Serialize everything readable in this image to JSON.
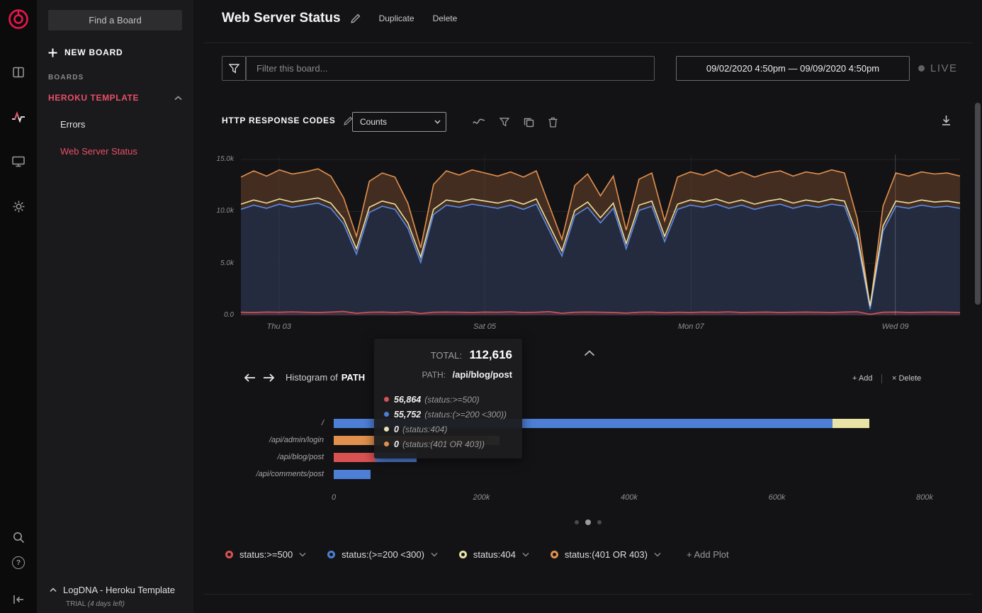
{
  "app": {
    "accent": "#e94f68",
    "logo_color": "#e8174c"
  },
  "sidebar": {
    "search_placeholder": "Find a Board",
    "new_board_label": "NEW BOARD",
    "boards_section_label": "BOARDS",
    "group_label": "HEROKU TEMPLATE",
    "boards": [
      {
        "label": "Errors",
        "active": false
      },
      {
        "label": "Web Server Status",
        "active": true
      }
    ],
    "footer_title": "LogDNA - Heroku Template",
    "footer_trial": "TRIAL",
    "footer_trial_note": "(4 days left)"
  },
  "header": {
    "title": "Web Server Status",
    "duplicate_label": "Duplicate",
    "delete_label": "Delete"
  },
  "filter_bar": {
    "filter_placeholder": "Filter this board...",
    "date_range": "09/02/2020 4:50pm — 09/09/2020 4:50pm",
    "live_label": "LIVE"
  },
  "timeseries_panel": {
    "title": "HTTP RESPONSE CODES",
    "metric_selected": "Counts"
  },
  "histogram_panel": {
    "title_prefix": "Histogram of",
    "title_field": "PATH",
    "add_label": "+ Add",
    "delete_label": "× Delete"
  },
  "tooltip": {
    "total_label": "TOTAL:",
    "total_value": "112,616",
    "path_label": "PATH:",
    "path_value": "/api/blog/post",
    "rows": [
      {
        "color": "#d95252",
        "value": "56,864",
        "query": "(status:>=500)"
      },
      {
        "color": "#4d7fd6",
        "value": "55,752",
        "query": "(status:(>=200 <300))"
      },
      {
        "color": "#e6e2b8",
        "value": "0",
        "query": "(status:404)"
      },
      {
        "color": "#e2904e",
        "value": "0",
        "query": "(status:(401 OR 403))"
      }
    ]
  },
  "legend": {
    "items": [
      {
        "label": "status:>=500",
        "color": "#d95252"
      },
      {
        "label": "status:(>=200 <300)",
        "color": "#4d7fd6"
      },
      {
        "label": "status:404",
        "color": "#e9e3a6"
      },
      {
        "label": "status:(401 OR 403)",
        "color": "#e2904e"
      }
    ],
    "add_plot_label": "+ Add Plot"
  },
  "chart_data": [
    {
      "type": "area",
      "title": "HTTP RESPONSE CODES",
      "x_range": [
        "09/02/2020 4:50pm",
        "09/09/2020 4:50pm"
      ],
      "y_unit": "thousands",
      "y_max": 15,
      "y_ticks": [
        {
          "label": "15.0k",
          "value": 15
        },
        {
          "label": "10.0k",
          "value": 10
        },
        {
          "label": "5.0k",
          "value": 5
        },
        {
          "label": "0.0",
          "value": 0
        }
      ],
      "x_ticks": [
        {
          "label": "Thu 03",
          "frac": 0.053
        },
        {
          "label": "Sat 05",
          "frac": 0.339
        },
        {
          "label": "Mon 07",
          "frac": 0.626
        },
        {
          "label": "Wed 09",
          "frac": 0.91
        }
      ],
      "series": [
        {
          "name": "status:(401 OR 403)",
          "color": "#e2904e",
          "fill": "rgba(196,118,60,0.27)",
          "values": [
            13.3,
            13.9,
            13.4,
            14.0,
            13.6,
            13.8,
            14.1,
            13.4,
            11.3,
            7.6,
            12.9,
            13.7,
            13.3,
            10.8,
            6.5,
            12.6,
            13.9,
            13.5,
            14.0,
            13.7,
            13.4,
            13.8,
            13.3,
            13.9,
            10.6,
            7.3,
            12.5,
            13.6,
            11.5,
            13.4,
            8.2,
            13.1,
            13.7,
            9.1,
            13.3,
            13.8,
            13.5,
            14.0,
            13.4,
            13.8,
            13.3,
            13.7,
            13.9,
            13.4,
            13.8,
            13.6,
            14.0,
            13.7,
            9.3,
            0.8,
            10.5,
            13.7,
            13.4,
            13.8,
            13.6,
            13.7,
            13.4
          ]
        },
        {
          "name": "status:(>=200 <300)",
          "color": "#5c8ae6",
          "fill": "rgba(34,43,66,0.93)",
          "values": [
            10.2,
            10.6,
            10.3,
            10.7,
            10.4,
            10.6,
            10.8,
            10.3,
            8.8,
            5.9,
            9.9,
            10.5,
            10.2,
            8.4,
            5.1,
            9.7,
            10.6,
            10.4,
            10.7,
            10.5,
            10.3,
            10.6,
            10.2,
            10.7,
            8.2,
            5.7,
            9.6,
            10.4,
            8.9,
            10.3,
            6.4,
            10.1,
            10.5,
            7.1,
            10.2,
            10.6,
            10.4,
            10.7,
            10.3,
            10.6,
            10.2,
            10.5,
            10.7,
            10.3,
            10.6,
            10.4,
            10.7,
            10.5,
            7.2,
            0.6,
            8.1,
            10.5,
            10.3,
            10.6,
            10.4,
            10.5,
            10.3
          ]
        },
        {
          "name": "status:404",
          "color": "#eadfa3",
          "fill": "none",
          "values": [
            10.7,
            11.1,
            10.8,
            11.2,
            10.9,
            11.1,
            11.3,
            10.8,
            9.3,
            6.4,
            10.4,
            11.0,
            10.7,
            8.9,
            5.6,
            10.2,
            11.1,
            10.9,
            11.2,
            11.0,
            10.8,
            11.1,
            10.7,
            11.2,
            8.7,
            6.2,
            10.1,
            10.9,
            9.4,
            10.8,
            6.9,
            10.6,
            11.0,
            7.6,
            10.7,
            11.1,
            10.9,
            11.2,
            10.8,
            11.1,
            10.7,
            11.0,
            11.2,
            10.8,
            11.1,
            10.9,
            11.2,
            11.0,
            7.7,
            0.9,
            8.6,
            11.0,
            10.8,
            11.1,
            10.9,
            11.0,
            10.8
          ]
        },
        {
          "name": "status:>=500",
          "color": "#d95252",
          "fill": "rgba(217,82,82,0.18)",
          "values": [
            0.3,
            0.28,
            0.32,
            0.3,
            0.34,
            0.3,
            0.28,
            0.32,
            0.38,
            0.2,
            0.3,
            0.32,
            0.28,
            0.35,
            0.18,
            0.3,
            0.32,
            0.3,
            0.28,
            0.32,
            0.3,
            0.34,
            0.28,
            0.3,
            0.36,
            0.2,
            0.3,
            0.32,
            0.3,
            0.28,
            0.22,
            0.3,
            0.32,
            0.25,
            0.3,
            0.28,
            0.32,
            0.3,
            0.34,
            0.28,
            0.3,
            0.32,
            0.28,
            0.3,
            0.32,
            0.3,
            0.28,
            0.32,
            0.35,
            0.1,
            0.3,
            0.32,
            0.28,
            0.3,
            0.32,
            0.3,
            0.28
          ]
        }
      ]
    },
    {
      "type": "bar",
      "title": "Histogram of PATH",
      "x_max": 800000,
      "x_ticks": [
        "0",
        "200k",
        "400k",
        "600k",
        "800k"
      ],
      "rows": [
        {
          "path": "/",
          "segments": [
            {
              "series": "status:(>=200 <300)",
              "color": "#4d7fd6",
              "value": 675000
            },
            {
              "series": "status:404",
              "color": "#e9e3a6",
              "value": 50000
            }
          ]
        },
        {
          "path": "/api/admin/login",
          "segments": [
            {
              "series": "status:(401 OR 403)",
              "color": "#e2904e",
              "value": 208000
            },
            {
              "series": "status:404",
              "color": "#e9e3a6",
              "value": 17000
            }
          ]
        },
        {
          "path": "/api/blog/post",
          "segments": [
            {
              "series": "status:>=500",
              "color": "#d95252",
              "value": 56864
            },
            {
              "series": "status:(>=200 <300)",
              "color": "#4d7fd6",
              "value": 55752
            }
          ]
        },
        {
          "path": "/api/comments/post",
          "segments": [
            {
              "series": "status:(>=200 <300)",
              "color": "#4d7fd6",
              "value": 50000
            }
          ]
        }
      ]
    }
  ]
}
